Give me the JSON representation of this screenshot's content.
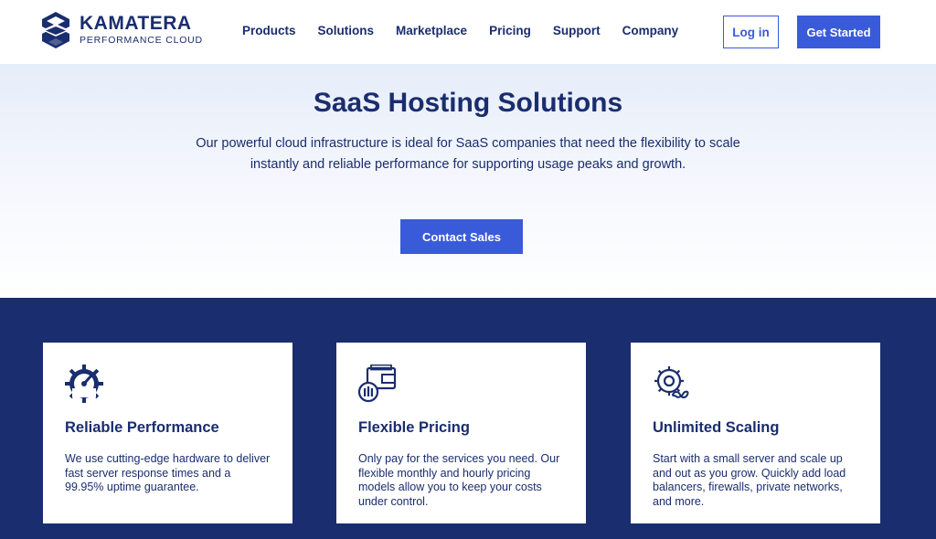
{
  "brand": {
    "name": "KAMATERA",
    "tagline": "PERFORMANCE CLOUD"
  },
  "nav": [
    {
      "label": "Products"
    },
    {
      "label": "Solutions"
    },
    {
      "label": "Marketplace"
    },
    {
      "label": "Pricing"
    },
    {
      "label": "Support"
    },
    {
      "label": "Company"
    }
  ],
  "header": {
    "login_label": "Log in",
    "start_label": "Get Started"
  },
  "hero": {
    "title": "SaaS Hosting Solutions",
    "subtitle": "Our powerful cloud infrastructure is ideal for SaaS companies that need the flexibility to scale instantly and reliable performance for supporting usage peaks and growth.",
    "cta_label": "Contact Sales"
  },
  "features": [
    {
      "icon": "speedometer-gear-icon",
      "title": "Reliable Performance",
      "text": "We use cutting-edge hardware to deliver fast server response times and a 99.95% uptime guarantee."
    },
    {
      "icon": "wallet-coins-icon",
      "title": "Flexible Pricing",
      "text": "Only pay for the services you need. Our flexible monthly and hourly pricing models allow you to keep your costs under control."
    },
    {
      "icon": "gear-infinity-icon",
      "title": "Unlimited Scaling",
      "text": "Start with a small server and scale up and out as you grow. Quickly add load balancers, firewalls, private networks, and more."
    }
  ],
  "colors": {
    "navy": "#1a2d6e",
    "accent": "#3a5bd9",
    "hero_bg": "#e6edfa"
  }
}
